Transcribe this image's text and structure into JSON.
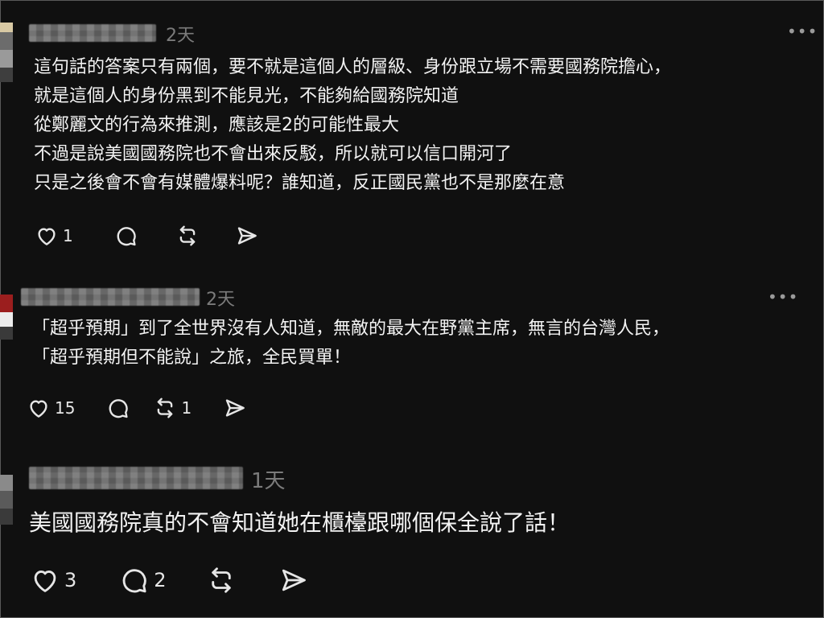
{
  "posts": [
    {
      "time": "2天",
      "lines": [
        "這句話的答案只有兩個，要不就是這個人的層級、身份跟立場不需要國務院擔心，",
        "就是這個人的身份黑到不能見光，不能夠給國務院知道",
        "從鄭麗文的行為來推測，應該是2的可能性最大",
        "不過是說美國國務院也不會出來反駁，所以就可以信口開河了",
        "只是之後會不會有媒體爆料呢？誰知道，反正國民黨也不是那麼在意"
      ],
      "like_count": "1",
      "comment_count": "",
      "repost_count": ""
    },
    {
      "time": "2天",
      "lines": [
        "「超乎預期」到了全世界沒有人知道，無敵的最大在野黨主席，無言的台灣人民，",
        "「超乎預期但不能說」之旅，全民買單！"
      ],
      "like_count": "15",
      "comment_count": "",
      "repost_count": "1"
    },
    {
      "time": "1天",
      "lines": [
        "美國國務院真的不會知道她在櫃檯跟哪個保全說了話！"
      ],
      "like_count": "3",
      "comment_count": "2",
      "repost_count": ""
    }
  ],
  "more_label": "•••",
  "icons": [
    "heart-icon",
    "comment-icon",
    "repost-icon",
    "share-icon",
    "more-icon"
  ]
}
